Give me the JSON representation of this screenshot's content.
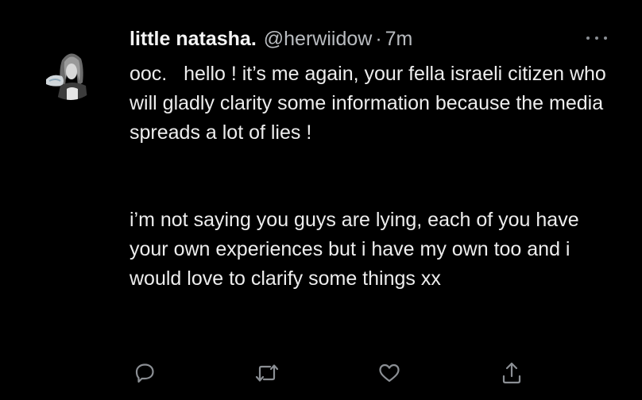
{
  "tweet": {
    "display_name": "little natasha.",
    "handle": "@herwiidow",
    "separator": "·",
    "time": "7m",
    "paragraph1": "ooc.   hello ! it’s me again, your fella israeli citizen who will gladly clarity some information because the media spreads a lot of lies !",
    "paragraph2": "i’m not saying you guys are lying, each of you have your own experiences but i have my own too and i would love to clarify some things xx"
  },
  "actions": {
    "reply_icon": "speech-bubble-icon",
    "retweet_icon": "retweet-arrows-icon",
    "like_icon": "heart-icon",
    "share_icon": "share-upload-icon"
  },
  "colors": {
    "background": "#000000",
    "text": "#e7e9ea",
    "secondary": "#b9bcc0",
    "icon": "#8b8f94"
  }
}
